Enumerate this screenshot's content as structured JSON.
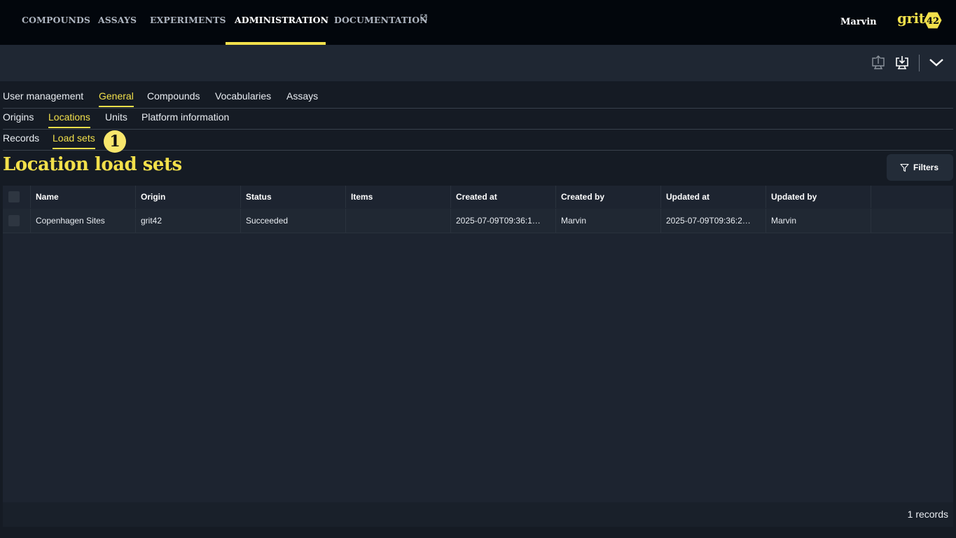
{
  "topnav": {
    "items": [
      "COMPOUNDS",
      "ASSAYS",
      "EXPERIMENTS",
      "ADMINISTRATION",
      "DOCUMENTATION"
    ],
    "active": "ADMINISTRATION",
    "user": "Marvin",
    "logo_text": "grit",
    "logo_badge": "42"
  },
  "toolbar": {
    "icons": [
      "upload-icon",
      "download-icon",
      "chevron-down-icon"
    ]
  },
  "tabs_level1": [
    "User management",
    "General",
    "Compounds",
    "Vocabularies",
    "Assays"
  ],
  "tabs_level2": [
    "Origins",
    "Locations",
    "Units",
    "Platform information"
  ],
  "tabs_level3": [
    "Records",
    "Load sets"
  ],
  "annotation_badge": "1",
  "page_title": "Location load sets",
  "filters_label": "Filters",
  "table": {
    "columns": [
      "Name",
      "Origin",
      "Status",
      "Items",
      "Created at",
      "Created by",
      "Updated at",
      "Updated by"
    ],
    "rows": [
      [
        "Copenhagen Sites",
        "grit42",
        "Succeeded",
        "",
        "2025-07-09T09:36:1…",
        "Marvin",
        "2025-07-09T09:36:2…",
        "Marvin"
      ]
    ]
  },
  "records_count": "1 records",
  "colors": {
    "accent": "#f2e04b",
    "nav_bg": "#02060c",
    "page_bg": "#151b24"
  }
}
